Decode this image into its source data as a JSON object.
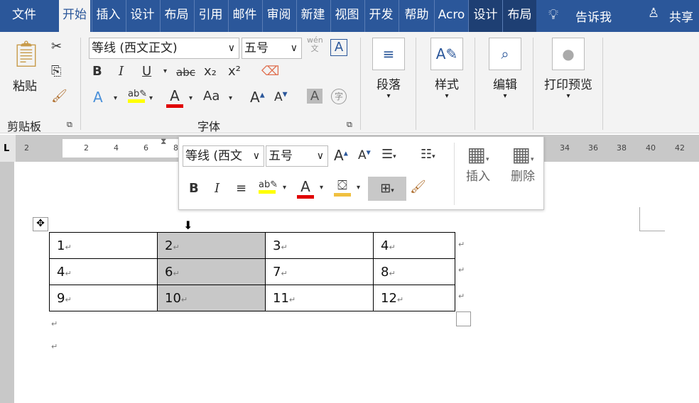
{
  "tabs": [
    "文件",
    "开始",
    "插入",
    "设计",
    "布局",
    "引用",
    "邮件",
    "审阅",
    "新建",
    "视图",
    "开发",
    "帮助",
    "Acro",
    "设计",
    "布局"
  ],
  "tell_me": "告诉我",
  "share": "共享",
  "ribbon": {
    "paste": "粘贴",
    "clipboard": "剪贴板",
    "font_group": "字体",
    "font_name": "等线 (西文正文)",
    "font_size": "五号",
    "paragraph": "段落",
    "styles": "样式",
    "editing": "编辑",
    "print_preview": "打印预览",
    "bold": "B",
    "italic": "I",
    "underline": "U",
    "strike": "abc",
    "sub": "x₂",
    "sup": "x²",
    "wen": "wén",
    "grow": "Aa"
  },
  "ruler": {
    "ticks": [
      "2",
      "2",
      "4",
      "6",
      "8",
      "34",
      "36",
      "38",
      "40",
      "42"
    ]
  },
  "mini": {
    "font_name": "等线 (西文",
    "font_size": "五号",
    "insert": "插入",
    "delete": "删除"
  },
  "table": [
    [
      "1",
      "2",
      "3",
      "4"
    ],
    [
      "4",
      "6",
      "7",
      "8"
    ],
    [
      "9",
      "10",
      "11",
      "12"
    ]
  ],
  "shaded_column": 1,
  "colors": {
    "accent": "#2b579a",
    "highlight": "#ffff00",
    "font_color": "#e00000"
  }
}
